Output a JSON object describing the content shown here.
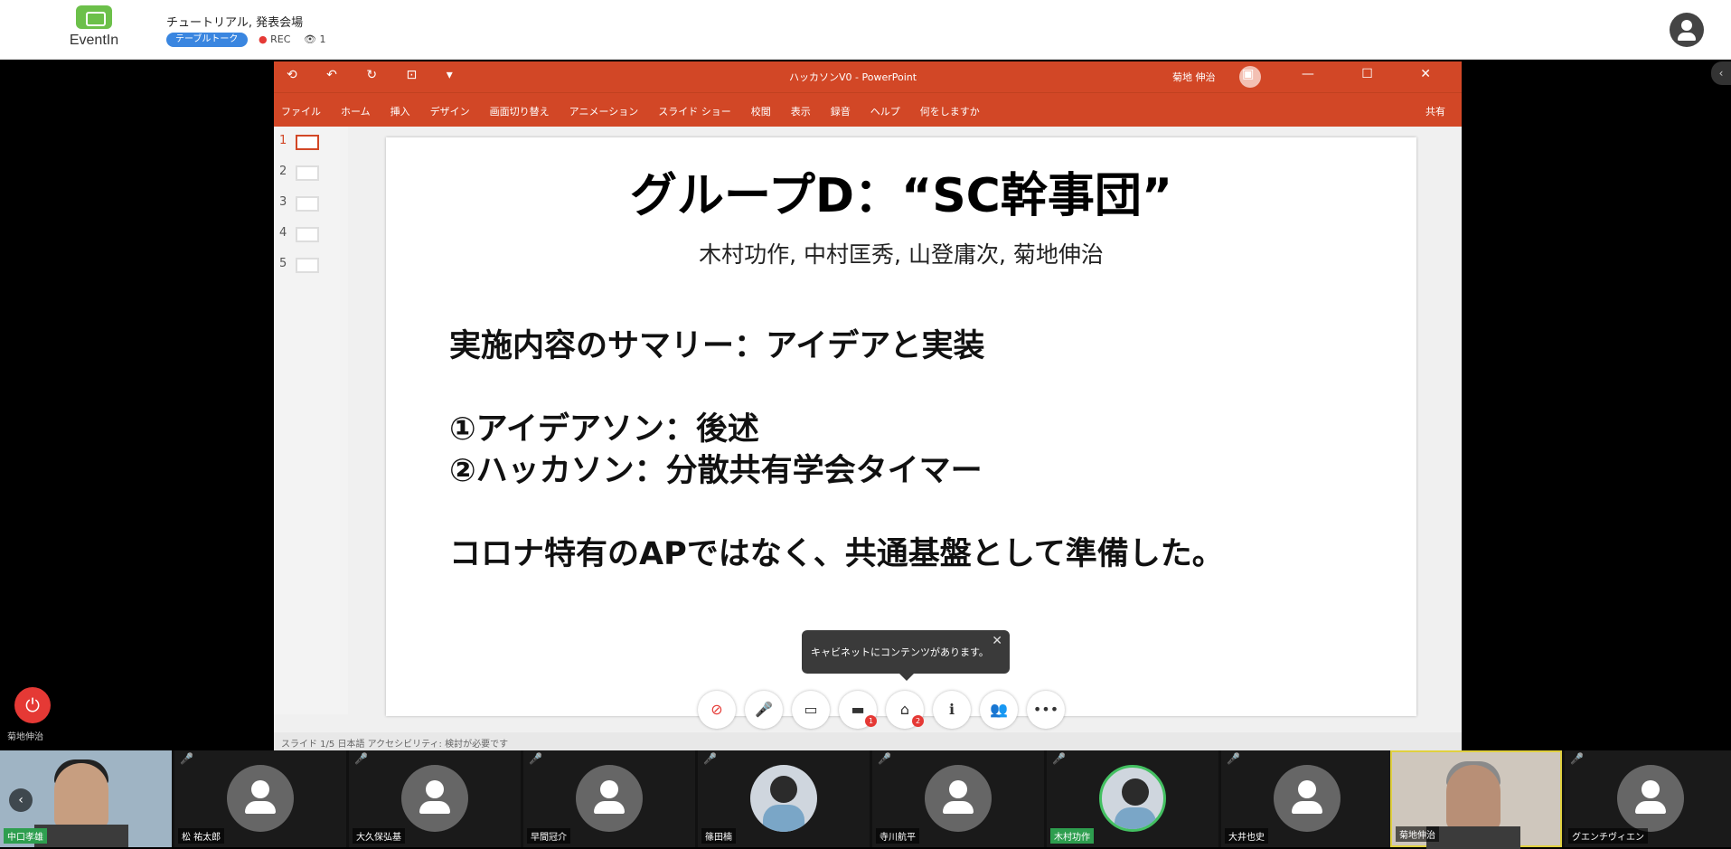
{
  "app": {
    "logo_text": "EventIn",
    "event_title": "チュートリアル, 発表会場",
    "tag": "テーブルトーク",
    "rec": "REC",
    "viewers": "1"
  },
  "ppt": {
    "quick_access": "⟲ ↶ ↻ ⊡ ▾",
    "doc_title": "ハッカソンV0 - PowerPoint",
    "user_name": "菊地 伸治",
    "window_controls": "▣ — ☐ ✕",
    "ribbon_tabs": [
      "ファイル",
      "ホーム",
      "挿入",
      "デザイン",
      "画面切り替え",
      "アニメーション",
      "スライド ショー",
      "校閲",
      "表示",
      "録音",
      "ヘルプ",
      "何をしますか"
    ],
    "share": "共有",
    "thumbs": [
      "1",
      "2",
      "3",
      "4",
      "5"
    ],
    "status": "スライド 1/5    日本語    アクセシビリティ: 検討が必要です"
  },
  "slide": {
    "title": "グループD：“SC幹事団”",
    "authors": "木村功作, 中村匡秀, 山登庸次, 菊地伸治",
    "lines": [
      "実施内容のサマリー：アイデアと実装",
      "①アイデアソン：後述",
      "②ハッカソン：分散共有学会タイマー",
      "コロナ特有のAPではなく、共通基盤として準備した。"
    ]
  },
  "tooltip": {
    "text": "キャビネットにコンテンツがあります。"
  },
  "toolbar": {
    "buttons": [
      {
        "icon": "camera-off-icon",
        "glyph": "⊘"
      },
      {
        "icon": "mic-off-icon",
        "glyph": "🎤"
      },
      {
        "icon": "screen-share-icon",
        "glyph": "▭"
      },
      {
        "icon": "chat-icon",
        "glyph": "▬",
        "badge": "1"
      },
      {
        "icon": "cabinet-icon",
        "glyph": "⌂",
        "badge": "2"
      },
      {
        "icon": "info-icon",
        "glyph": "ℹ"
      },
      {
        "icon": "participants-icon",
        "glyph": "👥"
      },
      {
        "icon": "more-icon",
        "glyph": "•••"
      }
    ]
  },
  "leave": {
    "label": "菊地伸治"
  },
  "participants": [
    {
      "name": "中口孝雄",
      "type": "video",
      "green": true
    },
    {
      "name": "松 祐太郎",
      "type": "avatar"
    },
    {
      "name": "大久保弘基",
      "type": "avatar"
    },
    {
      "name": "早間冠介",
      "type": "avatar"
    },
    {
      "name": "篠田楠",
      "type": "photo"
    },
    {
      "name": "寺川航平",
      "type": "avatar"
    },
    {
      "name": "木村功作",
      "type": "photo-ring",
      "green": true
    },
    {
      "name": "大井也史",
      "type": "avatar"
    },
    {
      "name": "菊地伸治",
      "type": "video-highlight"
    },
    {
      "name": "グエンチヴィエン",
      "type": "avatar"
    }
  ]
}
